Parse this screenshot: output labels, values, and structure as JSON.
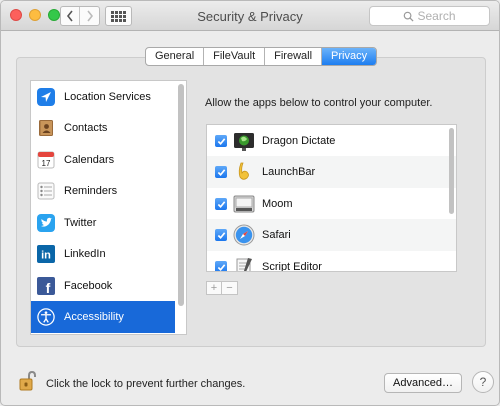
{
  "window": {
    "title": "Security & Privacy"
  },
  "toolbar": {
    "search_placeholder": "Search",
    "back_icon": "chevron-left-icon",
    "forward_icon": "chevron-right-icon",
    "show_all_icon": "grid-icon"
  },
  "tabs": [
    {
      "label": "General",
      "active": false
    },
    {
      "label": "FileVault",
      "active": false
    },
    {
      "label": "Firewall",
      "active": false
    },
    {
      "label": "Privacy",
      "active": true
    }
  ],
  "sidebar": {
    "items": [
      {
        "label": "Location Services",
        "icon": "location-arrow-icon",
        "selected": false
      },
      {
        "label": "Contacts",
        "icon": "contacts-book-icon",
        "selected": false
      },
      {
        "label": "Calendars",
        "icon": "calendar-icon",
        "selected": false
      },
      {
        "label": "Reminders",
        "icon": "reminders-list-icon",
        "selected": false
      },
      {
        "label": "Twitter",
        "icon": "twitter-bird-icon",
        "selected": false
      },
      {
        "label": "LinkedIn",
        "icon": "linkedin-icon",
        "selected": false
      },
      {
        "label": "Facebook",
        "icon": "facebook-icon",
        "selected": false
      },
      {
        "label": "Accessibility",
        "icon": "accessibility-icon",
        "selected": true
      }
    ]
  },
  "main": {
    "prompt": "Allow the apps below to control your computer.",
    "apps": [
      {
        "name": "Dragon Dictate",
        "checked": true,
        "icon": "dragon-dictate-icon"
      },
      {
        "name": "LaunchBar",
        "checked": true,
        "icon": "launchbar-icon"
      },
      {
        "name": "Moom",
        "checked": true,
        "icon": "moom-icon"
      },
      {
        "name": "Safari",
        "checked": true,
        "icon": "safari-compass-icon"
      },
      {
        "name": "Script Editor",
        "checked": true,
        "icon": "script-editor-icon"
      }
    ],
    "add_label": "+",
    "remove_label": "−"
  },
  "footer": {
    "lock_text": "Click the lock to prevent further changes.",
    "advanced_label": "Advanced…",
    "help_label": "?"
  },
  "colors": {
    "accent": "#1869d9",
    "tab_active": "#1d7df0",
    "checkbox": "#1b77ee"
  }
}
